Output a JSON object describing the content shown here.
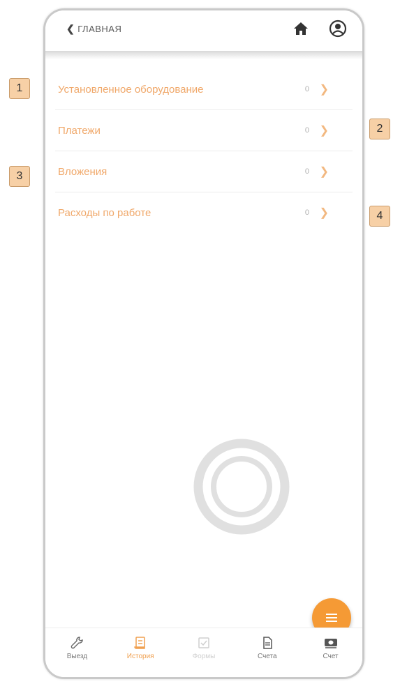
{
  "header": {
    "back_label": "ГЛАВНАЯ",
    "back_icon": "chevron-left-icon",
    "home_icon": "home-icon",
    "user_icon": "user-circle-icon"
  },
  "list": {
    "items": [
      {
        "label": "Установленное оборудование",
        "count": "0"
      },
      {
        "label": "Платежи",
        "count": "0"
      },
      {
        "label": "Вложения",
        "count": "0"
      },
      {
        "label": "Расходы по работе",
        "count": "0"
      }
    ]
  },
  "fab": {
    "icon": "menu-lines-icon",
    "color": "#f59a35"
  },
  "bottom_nav": {
    "items": [
      {
        "label": "Выезд",
        "icon": "wrench-icon"
      },
      {
        "label": "История",
        "icon": "scroll-icon"
      },
      {
        "label": "Формы",
        "icon": "checkbox-icon"
      },
      {
        "label": "Счета",
        "icon": "document-icon"
      },
      {
        "label": "Счет",
        "icon": "money-icon"
      }
    ]
  },
  "callouts": [
    "1",
    "2",
    "3",
    "4"
  ],
  "colors": {
    "accent": "#f0a86a",
    "fab": "#f59a35"
  }
}
